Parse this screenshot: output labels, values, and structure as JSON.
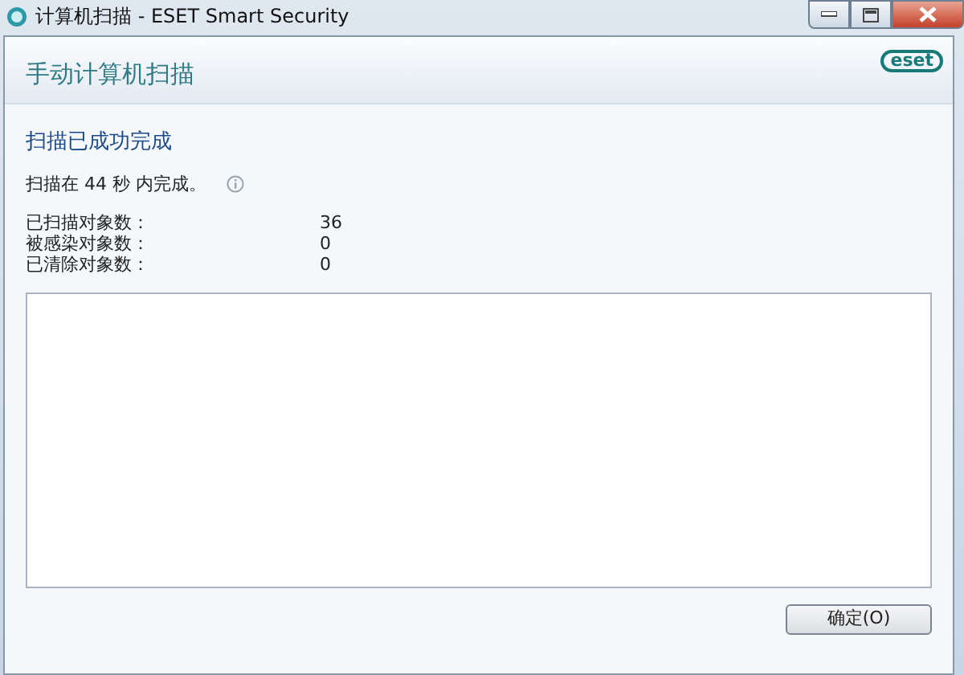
{
  "window": {
    "title": "计算机扫描 - ESET Smart Security"
  },
  "header": {
    "title": "手动计算机扫描",
    "logo": "eset"
  },
  "result": {
    "heading": "扫描已成功完成",
    "summary": "扫描在 44 秒 内完成。"
  },
  "stats": [
    {
      "label": "已扫描对象数：",
      "value": "36"
    },
    {
      "label": "被感染对象数：",
      "value": "0"
    },
    {
      "label": "已清除对象数：",
      "value": "0"
    }
  ],
  "buttons": [
    "确定(O)"
  ]
}
